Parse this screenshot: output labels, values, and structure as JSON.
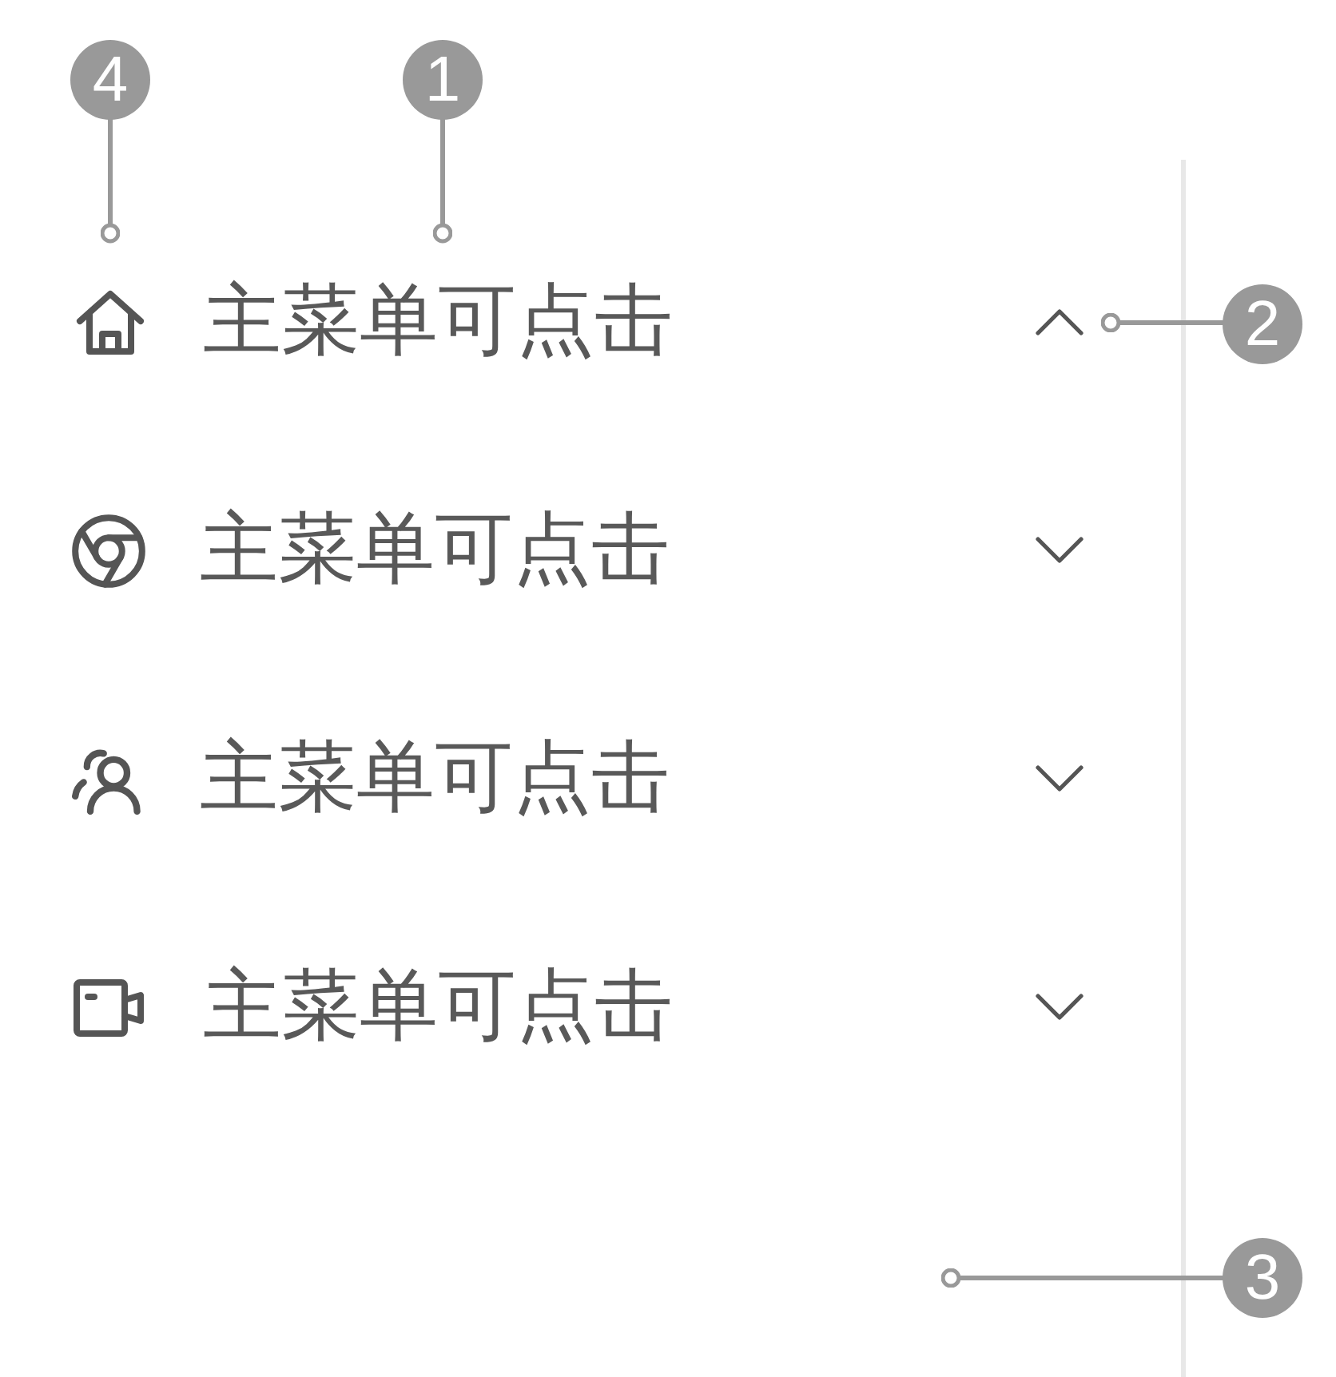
{
  "callouts": [
    {
      "number": "4"
    },
    {
      "number": "1"
    },
    {
      "number": "2"
    },
    {
      "number": "3"
    }
  ],
  "menu": {
    "items": [
      {
        "label": "主菜单可点击",
        "expanded": true
      },
      {
        "label": "主菜单可点击",
        "expanded": false
      },
      {
        "label": "主菜单可点击",
        "expanded": false
      },
      {
        "label": "主菜单可点击",
        "expanded": false
      }
    ]
  }
}
